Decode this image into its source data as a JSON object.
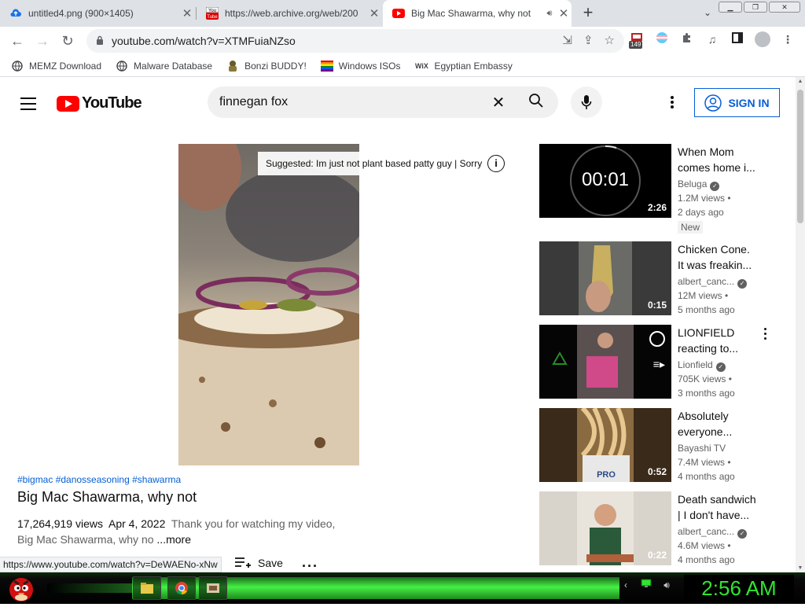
{
  "tabs": [
    {
      "title": "untitled4.png (900×1405)",
      "icon": "cloud-upload-icon",
      "active": false
    },
    {
      "title": "https://web.archive.org/web/200",
      "icon": "youtube-old-icon",
      "active": false
    },
    {
      "title": "Big Mac Shawarma, why not",
      "icon": "youtube-icon",
      "active": true
    }
  ],
  "omnibox": {
    "url": "youtube.com/watch?v=XTMFuiaNZso"
  },
  "extensions": {
    "badge": "149"
  },
  "bookmarks": [
    {
      "label": "MEMZ Download",
      "icon": "globe-icon"
    },
    {
      "label": "Malware Database",
      "icon": "globe-icon"
    },
    {
      "label": "Bonzi BUDDY!",
      "icon": "bonzi-icon"
    },
    {
      "label": "Windows ISOs",
      "icon": "windows-icon"
    },
    {
      "label": "Egyptian Embassy",
      "icon": "wix-icon"
    }
  ],
  "youtube": {
    "logo": "YouTube",
    "search_value": "finnegan fox",
    "sign_in": "SIGN IN"
  },
  "video": {
    "suggestion": "Suggested: Im just not plant based patty guy | Sorry",
    "hashtags": "#bigmac #danosseasoning #shawarma",
    "title": "Big Mac Shawarma, why not",
    "views": "17,264,919 views",
    "date": "Apr 4, 2022",
    "description": "Thank you for watching my video, Big Mac Shawarma, why no",
    "more": "...more",
    "save": "Save"
  },
  "status_url": "https://www.youtube.com/watch?v=DeWAENo-xNw",
  "recommendations": [
    {
      "line1": "When Mom",
      "line2": "comes home i...",
      "channel": "Beluga",
      "views": "1.2M views •",
      "age": "2 days ago",
      "duration": "2:26",
      "badge": "New",
      "timer": "00:01"
    },
    {
      "line1": "Chicken Cone.",
      "line2": "It was freakin...",
      "channel": "albert_canc...",
      "views": "12M views •",
      "age": "5 months ago",
      "duration": "0:15"
    },
    {
      "line1": "LIONFIELD",
      "line2": "reacting to...",
      "channel": "Lionfield",
      "views": "705K views •",
      "age": "3 months ago",
      "duration": ""
    },
    {
      "line1": "Absolutely",
      "line2": "everyone...",
      "channel": "Bayashi TV",
      "views": "7.4M views •",
      "age": "4 months ago",
      "duration": "0:52"
    },
    {
      "line1": "Death sandwich",
      "line2": "| I don't have...",
      "channel": "albert_canc...",
      "views": "4.6M views •",
      "age": "4 months ago",
      "duration": "0:22"
    }
  ],
  "taskbar": {
    "clock": "2:56 AM"
  },
  "colors": {
    "youtube_red": "#ff0000",
    "link_blue": "#065fd4",
    "taskbar_green": "#2fe62f"
  }
}
